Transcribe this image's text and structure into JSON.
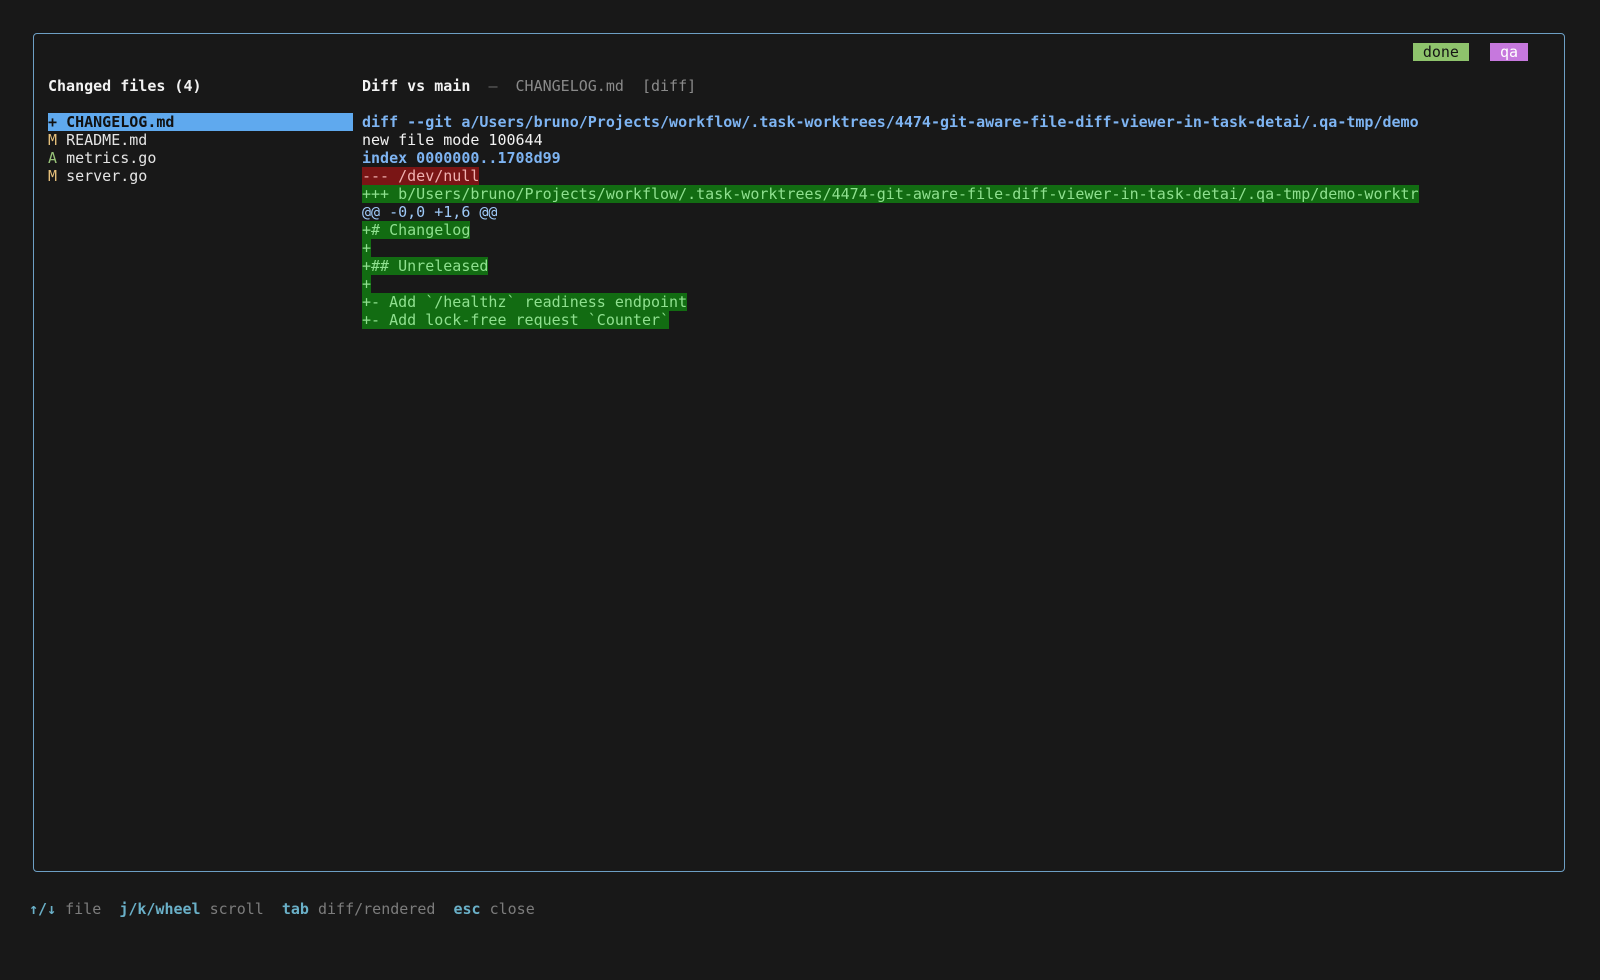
{
  "badges": {
    "done": "done",
    "qa": "qa"
  },
  "files_pane": {
    "title": "Changed files (4)",
    "files": [
      {
        "status": "+",
        "name": "CHANGELOG.md",
        "selected": true
      },
      {
        "status": "M",
        "name": "README.md",
        "selected": false
      },
      {
        "status": "A",
        "name": "metrics.go",
        "selected": false
      },
      {
        "status": "M",
        "name": "server.go",
        "selected": false
      }
    ]
  },
  "diff_pane": {
    "title": "Diff vs main",
    "separator": "—",
    "file": "CHANGELOG.md",
    "mode": "[diff]",
    "lines": [
      {
        "kind": "meta-blue",
        "text": "diff --git a/Users/bruno/Projects/workflow/.task-worktrees/4474-git-aware-file-diff-viewer-in-task-detai/.qa-tmp/demo"
      },
      {
        "kind": "meta-white",
        "text": "new file mode 100644"
      },
      {
        "kind": "meta-blue",
        "text": "index 0000000..1708d99"
      },
      {
        "kind": "del",
        "text": "--- /dev/null"
      },
      {
        "kind": "add",
        "text": "+++ b/Users/bruno/Projects/workflow/.task-worktrees/4474-git-aware-file-diff-viewer-in-task-detai/.qa-tmp/demo-worktr"
      },
      {
        "kind": "hunk",
        "text": "@@ -0,0 +1,6 @@"
      },
      {
        "kind": "add",
        "text": "+# Changelog"
      },
      {
        "kind": "add",
        "text": "+"
      },
      {
        "kind": "add",
        "text": "+## Unreleased"
      },
      {
        "kind": "add",
        "text": "+"
      },
      {
        "kind": "add",
        "text": "+- Add `/healthz` readiness endpoint"
      },
      {
        "kind": "add",
        "text": "+- Add lock-free request `Counter`"
      }
    ]
  },
  "footer": {
    "hints": [
      {
        "key": "↑/↓",
        "desc": "file"
      },
      {
        "key": "j/k/wheel",
        "desc": "scroll"
      },
      {
        "key": "tab",
        "desc": "diff/rendered"
      },
      {
        "key": "esc",
        "desc": "close"
      }
    ]
  }
}
